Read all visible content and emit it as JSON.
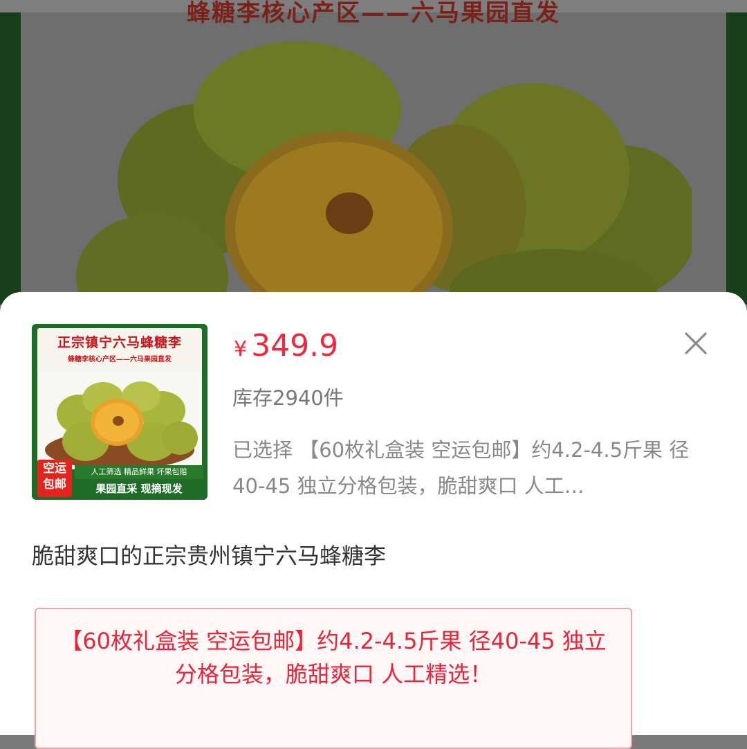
{
  "background": {
    "banner_text": "蜂糖李核心产区——六马果园直发"
  },
  "product_sheet": {
    "thumbnail": {
      "title": "正宗镇宁六马蜂糖李",
      "subtitle": "蜂糖李核心产区——六马果园直发",
      "badge": "空运\n包邮",
      "bar1": "人工筛选 精品鲜果 坏果包赔",
      "bar2": "果园直采 现摘现发"
    },
    "currency": "¥",
    "price": "349.9",
    "stock": "库存2940件",
    "selected": "已选择 【60枚礼盒装 空运包邮】约4.2-4.5斤果 径40-45 独立分格包装，脆甜爽口 人工…",
    "close_icon": "close-icon",
    "description": "脆甜爽口的正宗贵州镇宁六马蜂糖李",
    "sku_option": "【60枚礼盒装 空运包邮】约4.2-4.5斤果 径40-45 独立分格包装，脆甜爽口 人工精选！"
  },
  "colors": {
    "price": "#f0283c",
    "sku_border": "#f2a3a8",
    "sku_text": "#e8243a",
    "dim_overlay": "#7a7a7a"
  }
}
